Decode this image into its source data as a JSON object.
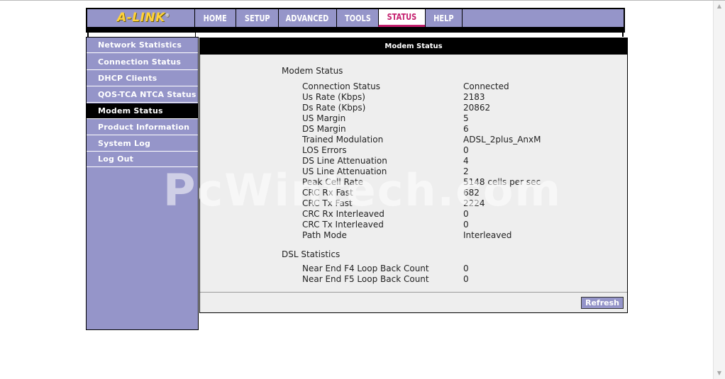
{
  "brand": {
    "logo_text": "A-LINK",
    "logo_mark": "®"
  },
  "nav": [
    {
      "label": "HOME"
    },
    {
      "label": "SETUP"
    },
    {
      "label": "ADVANCED"
    },
    {
      "label": "TOOLS"
    },
    {
      "label": "STATUS",
      "active": true
    },
    {
      "label": "HELP"
    }
  ],
  "sidebar": {
    "items": [
      {
        "label": "Network Statistics"
      },
      {
        "label": "Connection Status"
      },
      {
        "label": "DHCP Clients"
      },
      {
        "label": "QOS-TCA NTCA Status"
      },
      {
        "label": "Modem Status",
        "active": true
      },
      {
        "label": "Product Information"
      },
      {
        "label": "System Log"
      },
      {
        "label": "Log Out"
      }
    ]
  },
  "panel": {
    "title": "Modem Status",
    "modem_section_title": "Modem Status",
    "modem_rows": [
      {
        "label": "Connection Status",
        "value": "Connected"
      },
      {
        "label": "Us Rate (Kbps)",
        "value": "2183"
      },
      {
        "label": "Ds Rate (Kbps)",
        "value": "20862"
      },
      {
        "label": "US Margin",
        "value": "5"
      },
      {
        "label": "DS Margin",
        "value": "6"
      },
      {
        "label": "Trained Modulation",
        "value": "ADSL_2plus_AnxM"
      },
      {
        "label": "LOS Errors",
        "value": "0"
      },
      {
        "label": "DS Line Attenuation",
        "value": "4"
      },
      {
        "label": "US Line Attenuation",
        "value": "2"
      },
      {
        "label": "Peak Cell Rate",
        "value": "5148 cells per sec"
      },
      {
        "label": "CRC Rx Fast",
        "value": "682"
      },
      {
        "label": "CRC Tx Fast",
        "value": "2224"
      },
      {
        "label": "CRC Rx Interleaved",
        "value": "0"
      },
      {
        "label": "CRC Tx Interleaved",
        "value": "0"
      },
      {
        "label": "Path Mode",
        "value": "Interleaved"
      }
    ],
    "dsl_section_title": "DSL Statistics",
    "dsl_rows": [
      {
        "label": "Near End F4 Loop Back Count",
        "value": "0"
      },
      {
        "label": "Near End F5 Loop Back Count",
        "value": "0"
      }
    ],
    "refresh_label": "Refresh"
  },
  "watermark": "PcWintech.com",
  "colors": {
    "nav_bg": "#9595c9",
    "active_tab_text": "#c4206e",
    "logo": "#ffd23a",
    "panel_bg": "#eeeeee"
  }
}
